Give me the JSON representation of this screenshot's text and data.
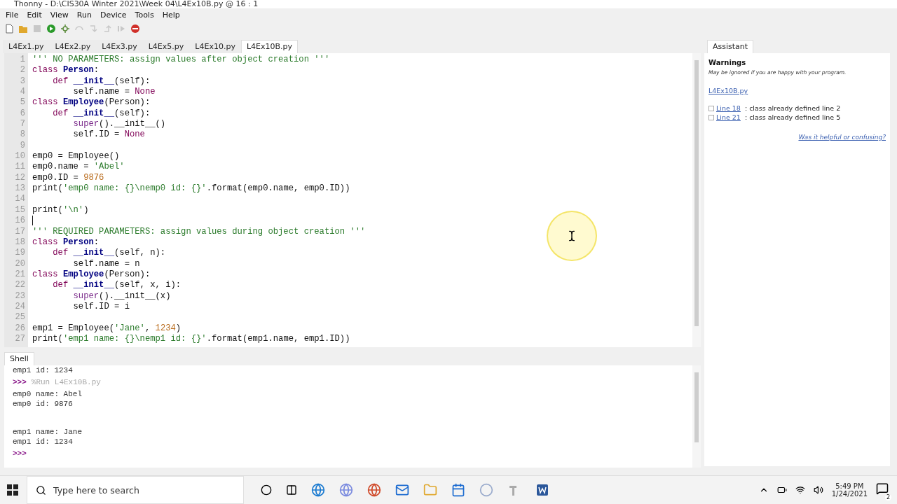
{
  "window": {
    "title": "Thonny  -  D:\\CIS30A Winter 2021\\Week 04\\L4Ex10B.py  @  16 : 1"
  },
  "menu": [
    "File",
    "Edit",
    "View",
    "Run",
    "Device",
    "Tools",
    "Help"
  ],
  "toolbar": [
    {
      "kind": "new",
      "disabled": false
    },
    {
      "kind": "open",
      "disabled": false
    },
    {
      "kind": "save",
      "disabled": true
    },
    {
      "kind": "run",
      "disabled": false
    },
    {
      "kind": "debug",
      "disabled": false
    },
    {
      "kind": "step-over",
      "disabled": true
    },
    {
      "kind": "step-into",
      "disabled": true
    },
    {
      "kind": "step-out",
      "disabled": true
    },
    {
      "kind": "resume",
      "disabled": true
    },
    {
      "kind": "stop",
      "disabled": false
    }
  ],
  "editor_tabs": [
    {
      "label": "L4Ex1.py",
      "selected": false
    },
    {
      "label": "L4Ex2.py",
      "selected": false
    },
    {
      "label": "L4Ex3.py",
      "selected": false
    },
    {
      "label": "L4Ex5.py",
      "selected": false
    },
    {
      "label": "L4Ex10.py",
      "selected": false
    },
    {
      "label": "L4Ex10B.py",
      "selected": true
    }
  ],
  "code": [
    {
      "number": "1",
      "tokens": [
        {
          "kind": "s",
          "text": "''' NO PARAMETERS: assign values after object creation '''"
        }
      ]
    },
    {
      "number": "2",
      "tokens": [
        {
          "kind": "k",
          "text": "class "
        },
        {
          "kind": "n",
          "text": "Person"
        },
        {
          "kind": "t",
          "text": ":"
        }
      ]
    },
    {
      "number": "3",
      "tokens": [
        {
          "kind": "k",
          "text": "    def "
        },
        {
          "kind": "n",
          "text": "__init__"
        },
        {
          "kind": "t",
          "text": "(self):"
        }
      ]
    },
    {
      "number": "4",
      "tokens": [
        {
          "kind": "t",
          "text": "        self.name = "
        },
        {
          "kind": "k",
          "text": "None"
        }
      ]
    },
    {
      "number": "5",
      "tokens": [
        {
          "kind": "k",
          "text": "class "
        },
        {
          "kind": "n",
          "text": "Employee"
        },
        {
          "kind": "t",
          "text": "(Person):"
        }
      ]
    },
    {
      "number": "6",
      "tokens": [
        {
          "kind": "k",
          "text": "    def "
        },
        {
          "kind": "n",
          "text": "__init__"
        },
        {
          "kind": "t",
          "text": "(self):"
        }
      ]
    },
    {
      "number": "7",
      "tokens": [
        {
          "kind": "b",
          "text": "        super"
        },
        {
          "kind": "t",
          "text": "().__init__()"
        }
      ]
    },
    {
      "number": "8",
      "tokens": [
        {
          "kind": "t",
          "text": "        self.ID = "
        },
        {
          "kind": "k",
          "text": "None"
        }
      ]
    },
    {
      "number": "9"
    },
    {
      "number": "10",
      "tokens": [
        {
          "kind": "t",
          "text": "emp0 = Employee()"
        }
      ]
    },
    {
      "number": "11",
      "tokens": [
        {
          "kind": "t",
          "text": "emp0.name = "
        },
        {
          "kind": "s",
          "text": "'Abel'"
        }
      ]
    },
    {
      "number": "12",
      "tokens": [
        {
          "kind": "t",
          "text": "emp0.ID = "
        },
        {
          "kind": "d",
          "text": "9876"
        }
      ]
    },
    {
      "number": "13",
      "tokens": [
        {
          "kind": "t",
          "text": "print("
        },
        {
          "kind": "s",
          "text": "'emp0 name: {}\\nemp0 id: {}'"
        },
        {
          "kind": "t",
          "text": ".format(emp0.name, emp0.ID))"
        }
      ]
    },
    {
      "number": "14"
    },
    {
      "number": "15",
      "tokens": [
        {
          "kind": "t",
          "text": "print("
        },
        {
          "kind": "s",
          "text": "'\\n'"
        },
        {
          "kind": "t",
          "text": ")"
        }
      ]
    },
    {
      "number": "16",
      "caret": true
    },
    {
      "number": "17",
      "tokens": [
        {
          "kind": "s",
          "text": "''' REQUIRED PARAMETERS: assign values during object creation '''"
        }
      ]
    },
    {
      "number": "18",
      "tokens": [
        {
          "kind": "k",
          "text": "class "
        },
        {
          "kind": "n",
          "text": "Person"
        },
        {
          "kind": "t",
          "text": ":"
        }
      ]
    },
    {
      "number": "19",
      "tokens": [
        {
          "kind": "k",
          "text": "    def "
        },
        {
          "kind": "n",
          "text": "__init__"
        },
        {
          "kind": "t",
          "text": "(self, n):"
        }
      ]
    },
    {
      "number": "20",
      "tokens": [
        {
          "kind": "t",
          "text": "        self.name = n"
        }
      ]
    },
    {
      "number": "21",
      "tokens": [
        {
          "kind": "k",
          "text": "class "
        },
        {
          "kind": "n",
          "text": "Employee"
        },
        {
          "kind": "t",
          "text": "(Person):"
        }
      ]
    },
    {
      "number": "22",
      "tokens": [
        {
          "kind": "k",
          "text": "    def "
        },
        {
          "kind": "n",
          "text": "__init__"
        },
        {
          "kind": "t",
          "text": "(self, x, i):"
        }
      ]
    },
    {
      "number": "23",
      "tokens": [
        {
          "kind": "b",
          "text": "        super"
        },
        {
          "kind": "t",
          "text": "().__init__(x)"
        }
      ]
    },
    {
      "number": "24",
      "tokens": [
        {
          "kind": "t",
          "text": "        self.ID = i"
        }
      ]
    },
    {
      "number": "25"
    },
    {
      "number": "26",
      "tokens": [
        {
          "kind": "t",
          "text": "emp1 = Employee("
        },
        {
          "kind": "s",
          "text": "'Jane'"
        },
        {
          "kind": "t",
          "text": ", "
        },
        {
          "kind": "d",
          "text": "1234"
        },
        {
          "kind": "t",
          "text": ")"
        }
      ]
    },
    {
      "number": "27",
      "tokens": [
        {
          "kind": "t",
          "text": "print("
        },
        {
          "kind": "s",
          "text": "'emp1 name: {}\\nemp1 id: {}'"
        },
        {
          "kind": "t",
          "text": ".format(emp1.name, emp1.ID))"
        }
      ]
    }
  ],
  "assistant": {
    "tab": "Assistant",
    "heading": "Warnings",
    "note": "May be ignored if you are happy with your program.",
    "file_link": "L4Ex10B.py",
    "warnings": [
      {
        "link": "Line 18",
        "text": " : class already defined line 2"
      },
      {
        "link": "Line 21",
        "text": " : class already defined line 5"
      }
    ],
    "feedback_link": "Was it helpful or confusing?"
  },
  "shell": {
    "tab": "Shell",
    "lines": [
      {
        "kind": "output",
        "text": "emp1 id: 1234"
      },
      {
        "kind": "prompt",
        "prompt": ">>>",
        "text": "%Run L4Ex10B.py"
      },
      {
        "kind": "output",
        "text": "emp0 name: Abel"
      },
      {
        "kind": "output",
        "text": "emp0 id: 9876"
      },
      {
        "kind": "blank"
      },
      {
        "kind": "output",
        "text": "emp1 name: Jane"
      },
      {
        "kind": "output",
        "text": "emp1 id: 1234"
      },
      {
        "kind": "prompt",
        "prompt": ">>>"
      }
    ]
  },
  "taskbar": {
    "search_placeholder": "Type here to search",
    "time": "5:49 PM",
    "date": "1/24/2021",
    "notifications": "2"
  }
}
